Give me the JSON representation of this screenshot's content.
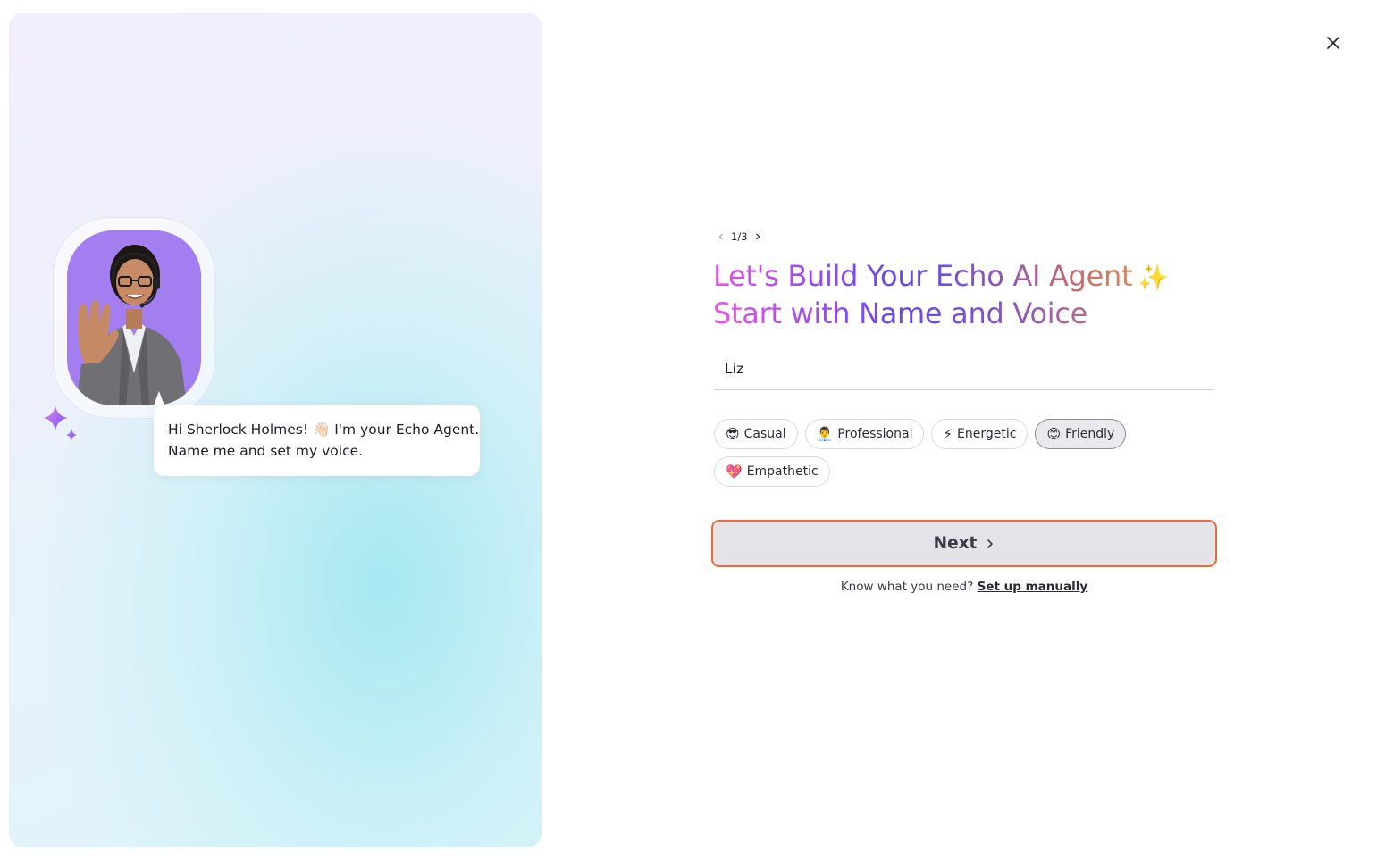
{
  "greeting": {
    "line1": "Hi Sherlock Holmes! 👋🏻 I'm your Echo Agent.",
    "line2": "Name me and set my voice."
  },
  "pager": {
    "text": "1/3"
  },
  "headline": {
    "line1": "Let's Build Your Echo AI Agent",
    "line1_emoji": "✨",
    "line2": "Start with Name and Voice"
  },
  "name_input": {
    "value": "Liz"
  },
  "voice_styles": [
    {
      "emoji": "😎",
      "label": "Casual",
      "selected": false
    },
    {
      "emoji": "👨‍💼",
      "label": "Professional",
      "selected": false
    },
    {
      "emoji": "⚡",
      "label": "Energetic",
      "selected": false
    },
    {
      "emoji": "😊",
      "label": "Friendly",
      "selected": true
    },
    {
      "emoji": "💖",
      "label": "Empathetic",
      "selected": false
    }
  ],
  "next_button": {
    "label": "Next"
  },
  "footer": {
    "prompt": "Know what you need?",
    "link": "Set up manually"
  },
  "icons": {
    "close": "close-icon",
    "pager_prev": "chevron-left-icon",
    "pager_next": "chevron-right-icon",
    "next_arrow": "chevron-right-icon",
    "sparkle": "sparkle-icon"
  },
  "colors": {
    "accent_border": "#f06a35",
    "next_bg": "#e6e6ea",
    "gradient_start": "#ee52e6",
    "gradient_mid": "#6148ee",
    "gradient_end": "#d78a5a",
    "avatar_bg": "#a27ef0"
  }
}
